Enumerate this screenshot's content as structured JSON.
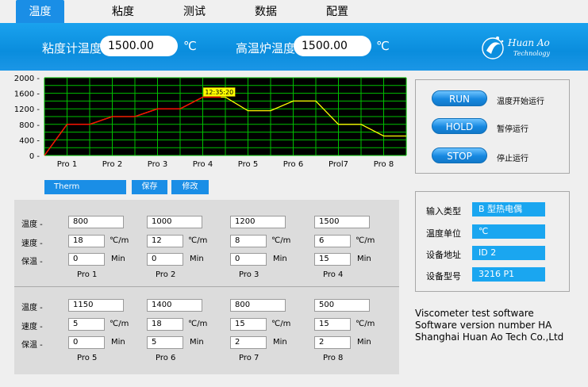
{
  "tabs": [
    {
      "label": "温度",
      "active": true
    },
    {
      "label": "粘度",
      "active": false
    },
    {
      "label": "测试",
      "active": false
    },
    {
      "label": "数据",
      "active": false
    },
    {
      "label": "配置",
      "active": false
    }
  ],
  "header": {
    "visc_temp_label": "粘度计温度",
    "visc_temp_value": "1500.00",
    "furnace_temp_label": "高温炉温度",
    "furnace_temp_value": "1500.00",
    "unit": "℃",
    "logo_text_1": "Huan Ao",
    "logo_text_2": "Technology"
  },
  "chart_data": {
    "type": "line",
    "categories": [
      "Pro 1",
      "Pro 2",
      "Pro 3",
      "Pro 4",
      "Pro 5",
      "Pro 6",
      "Prol7",
      "Pro 8"
    ],
    "yticks": [
      "2000 -",
      "1600 -",
      "1200 -",
      "800 -",
      "400 -",
      "0 -"
    ],
    "ylim": [
      0,
      2000
    ],
    "setpoint_series": {
      "color": "#ffff00",
      "points": [
        [
          0,
          0
        ],
        [
          0.5,
          800
        ],
        [
          1,
          800
        ],
        [
          1.5,
          1000
        ],
        [
          2,
          1000
        ],
        [
          2.5,
          1200
        ],
        [
          3,
          1200
        ],
        [
          3.5,
          1500
        ],
        [
          4,
          1500
        ],
        [
          4.5,
          1150
        ],
        [
          5,
          1150
        ],
        [
          5.5,
          1400
        ],
        [
          6,
          1400
        ],
        [
          6.5,
          800
        ],
        [
          7,
          800
        ],
        [
          7.5,
          500
        ],
        [
          8,
          500
        ]
      ]
    },
    "actual_series": {
      "color": "#ff0000",
      "points": [
        [
          0,
          0
        ],
        [
          0.5,
          800
        ],
        [
          1,
          800
        ],
        [
          1.5,
          1000
        ],
        [
          2,
          1000
        ],
        [
          2.5,
          1200
        ],
        [
          3,
          1200
        ],
        [
          3.5,
          1500
        ],
        [
          3.9,
          1500
        ]
      ]
    },
    "time_label": "12:35:20",
    "grid": true,
    "background": "#000000",
    "grid_color": "#00c000"
  },
  "controls": {
    "therm_label": "Therm",
    "save_label": "保存",
    "modify_label": "修改"
  },
  "profile": {
    "row_labels": [
      "温度 -",
      "速度 -",
      "保温 -"
    ],
    "rate_unit": "℃/m",
    "hold_unit": "Min",
    "segments": [
      {
        "name": "Pro 1",
        "temp": "800",
        "rate": "18",
        "hold": "0"
      },
      {
        "name": "Pro 2",
        "temp": "1000",
        "rate": "12",
        "hold": "0"
      },
      {
        "name": "Pro 3",
        "temp": "1200",
        "rate": "8",
        "hold": "0"
      },
      {
        "name": "Pro 4",
        "temp": "1500",
        "rate": "6",
        "hold": "15"
      },
      {
        "name": "Pro 5",
        "temp": "1150",
        "rate": "5",
        "hold": "0"
      },
      {
        "name": "Pro 6",
        "temp": "1400",
        "rate": "18",
        "hold": "5"
      },
      {
        "name": "Pro 7",
        "temp": "800",
        "rate": "15",
        "hold": "2"
      },
      {
        "name": "Pro 8",
        "temp": "500",
        "rate": "15",
        "hold": "2"
      }
    ]
  },
  "run_panel": {
    "run_label": "RUN",
    "run_desc": "温度开始运行",
    "hold_label": "HOLD",
    "hold_desc": "暂停运行",
    "stop_label": "STOP",
    "stop_desc": "停止运行"
  },
  "info": {
    "input_type_label": "输入类型",
    "input_type_value": "B 型热电偶",
    "temp_unit_label": "温度单位",
    "temp_unit_value": "℃",
    "address_label": "设备地址",
    "address_value": "ID 2",
    "model_label": "设备型号",
    "model_value": "3216 P1"
  },
  "footer": {
    "line1": "Viscometer test software",
    "line2": "Software version number HA",
    "line3": "Shanghai Huan Ao Tech Co.,Ltd"
  }
}
